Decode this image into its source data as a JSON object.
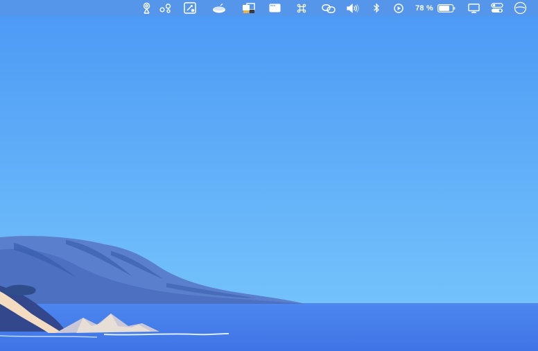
{
  "menubar": {
    "battery_percent": "78 %",
    "battery_level": 0.78,
    "items": [
      {
        "name": "airdrop-icon"
      },
      {
        "name": "connections-icon"
      },
      {
        "name": "edit-screenshot-icon"
      },
      {
        "name": "drive-icon"
      },
      {
        "name": "screens-icon"
      },
      {
        "name": "window-icon"
      },
      {
        "name": "command-key-icon"
      },
      {
        "name": "link-icon"
      },
      {
        "name": "volume-icon"
      },
      {
        "name": "bluetooth-icon"
      },
      {
        "name": "play-icon"
      },
      {
        "name": "battery-icon"
      },
      {
        "name": "display-icon"
      },
      {
        "name": "control-center-icon"
      },
      {
        "name": "clock-icon"
      }
    ]
  },
  "colors": {
    "menubar": "#5696e9",
    "sky_top": "#4a98f4",
    "sky_bottom": "#74c2fb",
    "sea": "#4a7fec",
    "mountain": "#5a7fcd",
    "mountain_dark": "#3b5fae",
    "rock_highlight": "#f6e0c2"
  }
}
